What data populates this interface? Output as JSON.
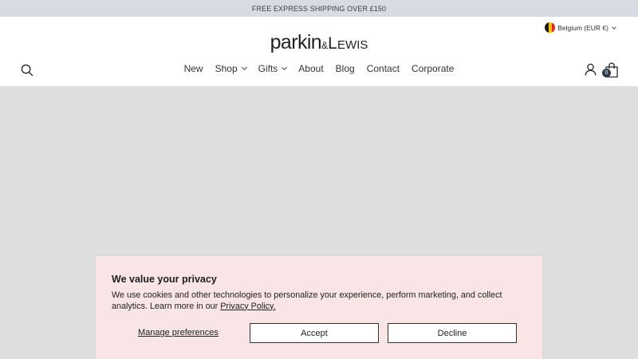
{
  "announcement": {
    "text": "FREE EXPRESS SHIPPING OVER £150"
  },
  "header": {
    "logo": {
      "part1": "parkin",
      "amp": "&",
      "part2": "L",
      "part3": "EWIS"
    },
    "locale": {
      "label": "Belgium (EUR €)",
      "flag_colors": [
        "#1a1a1a",
        "#f5c000",
        "#e1252b"
      ]
    },
    "nav": [
      {
        "label": "New",
        "has_dropdown": false
      },
      {
        "label": "Shop",
        "has_dropdown": true
      },
      {
        "label": "Gifts",
        "has_dropdown": true
      },
      {
        "label": "About",
        "has_dropdown": false
      },
      {
        "label": "Blog",
        "has_dropdown": false
      },
      {
        "label": "Contact",
        "has_dropdown": false
      },
      {
        "label": "Corporate",
        "has_dropdown": false
      }
    ],
    "cart_count": "0",
    "icons": {
      "search": "search-icon",
      "account": "account-icon",
      "cart": "shopping-bag-icon"
    }
  },
  "cookie_banner": {
    "title": "We value your privacy",
    "text": "We use cookies and other technologies to personalize your experience, perform marketing, and collect analytics. Learn more in our ",
    "link_label": "Privacy Policy.",
    "manage_label": "Manage preferences",
    "accept_label": "Accept",
    "decline_label": "Decline",
    "background": "#f9e5e6"
  }
}
